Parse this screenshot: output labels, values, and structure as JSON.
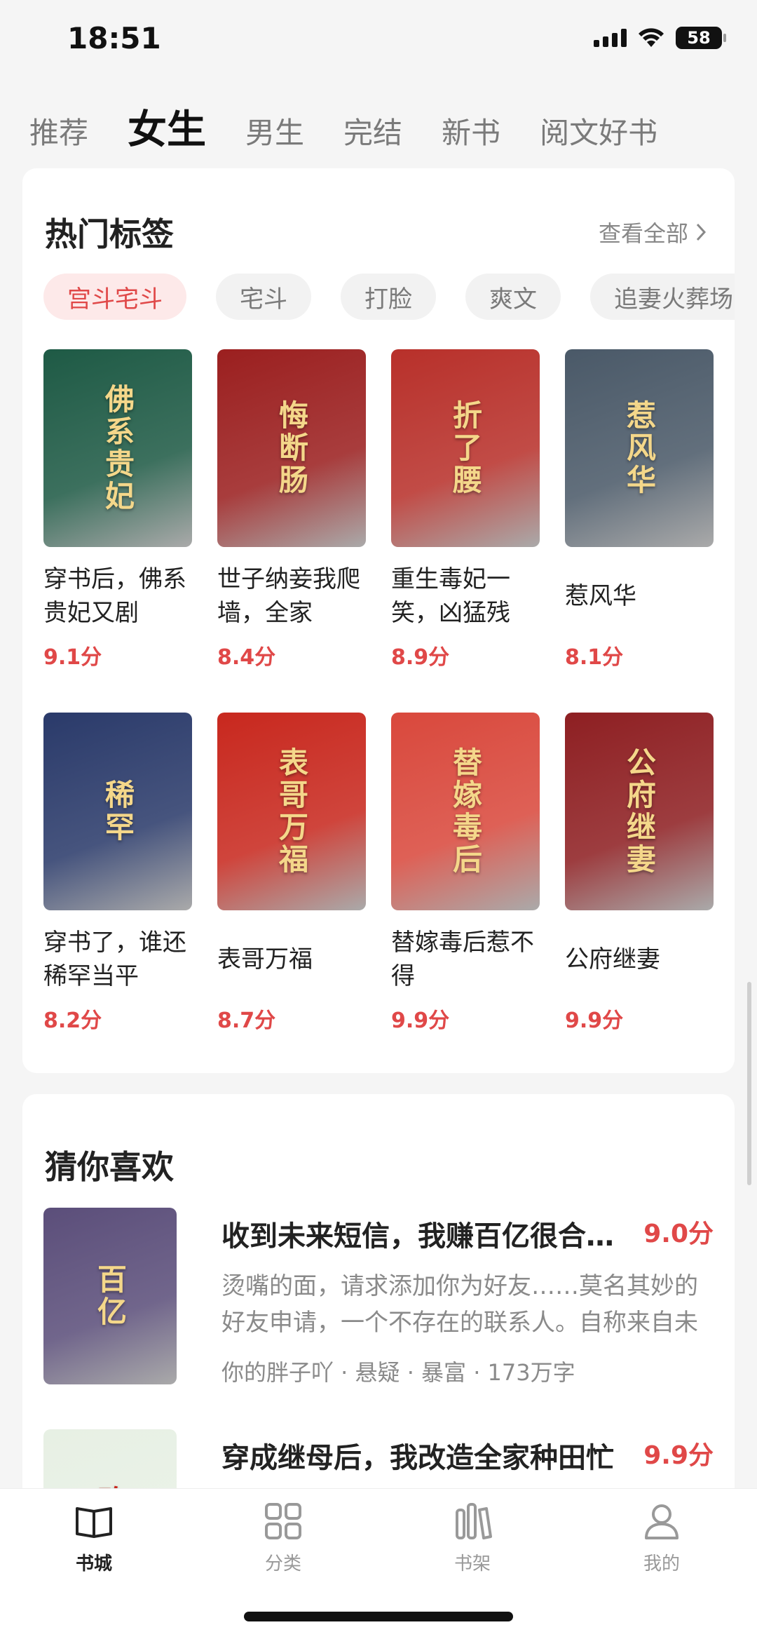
{
  "status": {
    "time": "18:51",
    "battery": "58"
  },
  "top_tabs": [
    "推荐",
    "女生",
    "男生",
    "完结",
    "新书",
    "阅文好书"
  ],
  "hot": {
    "title": "热门标签",
    "see_all": "查看全部",
    "tags": [
      "宫斗宅斗",
      "宅斗",
      "打脸",
      "爽文",
      "追妻火葬场"
    ],
    "books": [
      {
        "title": "穿书后，佛系贵妃又剧",
        "score": "9.1分",
        "cover_text": "佛系贵妃",
        "cover_color": "#1e5a45"
      },
      {
        "title": "世子纳妾我爬墙，全家",
        "score": "8.4分",
        "cover_text": "悔断肠",
        "cover_color": "#9b1f1f"
      },
      {
        "title": "重生毒妃一笑，凶猛残",
        "score": "8.9分",
        "cover_text": "折了腰",
        "cover_color": "#b8302a"
      },
      {
        "title": "惹风华",
        "score": "8.1分",
        "cover_text": "惹风华",
        "cover_color": "#4a5968"
      },
      {
        "title": "穿书了，谁还稀罕当平",
        "score": "8.2分",
        "cover_text": "稀罕",
        "cover_color": "#2a3a6a"
      },
      {
        "title": "表哥万福",
        "score": "8.7分",
        "cover_text": "表哥万福",
        "cover_color": "#c8281e"
      },
      {
        "title": "替嫁毒后惹不得",
        "score": "9.9分",
        "cover_text": "替嫁毒后",
        "cover_color": "#d9483c"
      },
      {
        "title": "公府继妻",
        "score": "9.9分",
        "cover_text": "公府继妻",
        "cover_color": "#8e1f22"
      }
    ]
  },
  "guess": {
    "title": "猜你喜欢",
    "items": [
      {
        "title": "收到未来短信，我赚百亿很合理吧",
        "score": "9.0分",
        "desc": "烫嘴的面，请求添加你为好友……莫名其妙的好友申请，一个不存在的联系人。自称来自未来",
        "meta": "你的胖子吖 · 悬疑 · 暴富 · 173万字",
        "cover_text": "百亿",
        "cover_color": "#5b4e7a"
      },
      {
        "title": "穿成继母后，我改造全家种田忙",
        "score": "9.9分",
        "desc": "",
        "meta": "",
        "cover_text": "改造",
        "cover_color": "#e7f0e4"
      }
    ]
  },
  "nav": [
    {
      "label": "书城",
      "icon": "book-open-icon"
    },
    {
      "label": "分类",
      "icon": "grid-icon"
    },
    {
      "label": "书架",
      "icon": "bookshelf-icon"
    },
    {
      "label": "我的",
      "icon": "user-icon"
    }
  ],
  "colors": {
    "accent": "#e04848",
    "tag_active_bg": "#fde9e9"
  }
}
